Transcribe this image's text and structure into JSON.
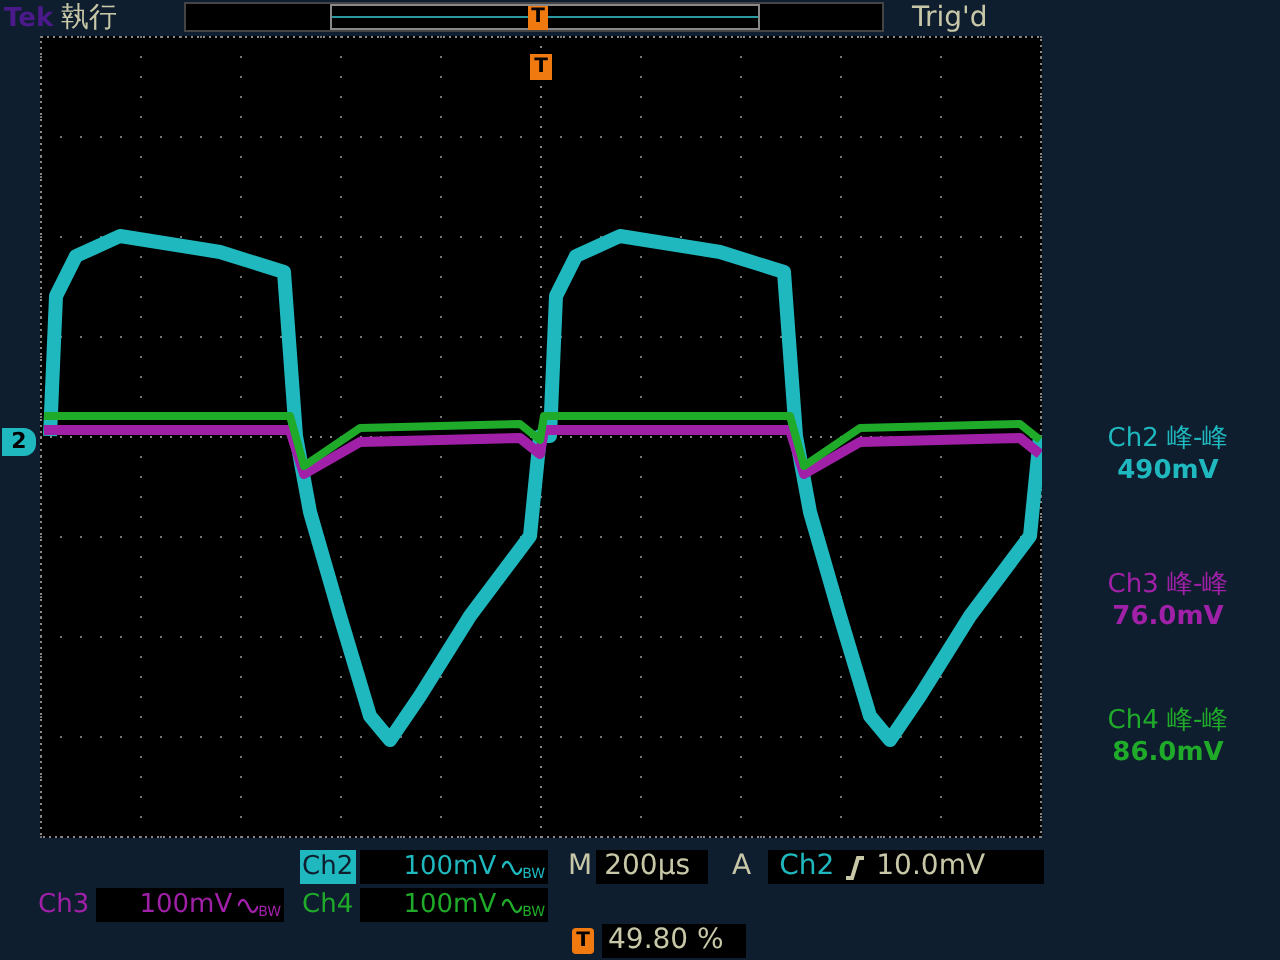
{
  "header": {
    "brand": "Tek",
    "mode": "執行",
    "trigger_status": "Trig'd",
    "trigger_marker": "T"
  },
  "trace_marker": "2",
  "graticule_trigger_marker": "T",
  "measurements": [
    {
      "channel": "Ch2",
      "label": "峰-峰",
      "value": "490mV",
      "color": "#1fb8bf"
    },
    {
      "channel": "Ch3",
      "label": "峰-峰",
      "value": "76.0mV",
      "color": "#a020a8"
    },
    {
      "channel": "Ch4",
      "label": "峰-峰",
      "value": "86.0mV",
      "color": "#1faa2a"
    }
  ],
  "channels": [
    {
      "name": "Ch2",
      "scale": "100mV",
      "bw": "BW",
      "selected": true,
      "color": "#1fb8bf"
    },
    {
      "name": "Ch3",
      "scale": "100mV",
      "bw": "BW",
      "selected": false,
      "color": "#a020a8"
    },
    {
      "name": "Ch4",
      "scale": "100mV",
      "bw": "BW",
      "selected": false,
      "color": "#1faa2a"
    }
  ],
  "timebase": {
    "label": "M",
    "value": "200µs"
  },
  "trigger": {
    "label": "A",
    "source": "Ch2",
    "level": "10.0mV"
  },
  "trigger_position": {
    "marker": "T",
    "value": "49.80 %"
  }
}
